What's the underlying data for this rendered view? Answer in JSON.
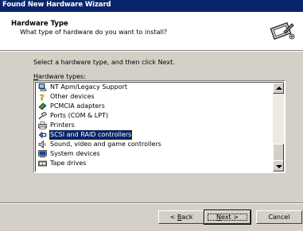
{
  "window": {
    "title": "Found New Hardware Wizard"
  },
  "header": {
    "title": "Hardware Type",
    "subtitle": "What type of hardware do you want to install?",
    "icon": "hardware-wizard-icon"
  },
  "body": {
    "instruction": "Select a hardware type, and then click Next.",
    "list_label_accel": "H",
    "list_label_rest": "ardware types:",
    "items": [
      {
        "label": "NT Apm/Legacy Support",
        "icon": "computer-icon",
        "selected": false
      },
      {
        "label": "Other devices",
        "icon": "question-icon",
        "selected": false
      },
      {
        "label": "PCMCIA adapters",
        "icon": "pcmcia-icon",
        "selected": false
      },
      {
        "label": "Ports (COM & LPT)",
        "icon": "port-icon",
        "selected": false
      },
      {
        "label": "Printers",
        "icon": "printer-icon",
        "selected": false
      },
      {
        "label": "SCSI and RAID controllers",
        "icon": "scsi-icon",
        "selected": true
      },
      {
        "label": "Sound, video and game controllers",
        "icon": "speaker-icon",
        "selected": false
      },
      {
        "label": "System devices",
        "icon": "system-icon",
        "selected": false
      },
      {
        "label": "Tape drives",
        "icon": "tape-icon",
        "selected": false
      }
    ]
  },
  "buttons": {
    "back_accel": "B",
    "back_rest": "ack",
    "next_accel": "N",
    "next_rest": "ext >",
    "cancel": "Cancel"
  },
  "colors": {
    "titlebar": "#0a246a",
    "selection": "#0a246a",
    "face": "#d4d0c8"
  }
}
